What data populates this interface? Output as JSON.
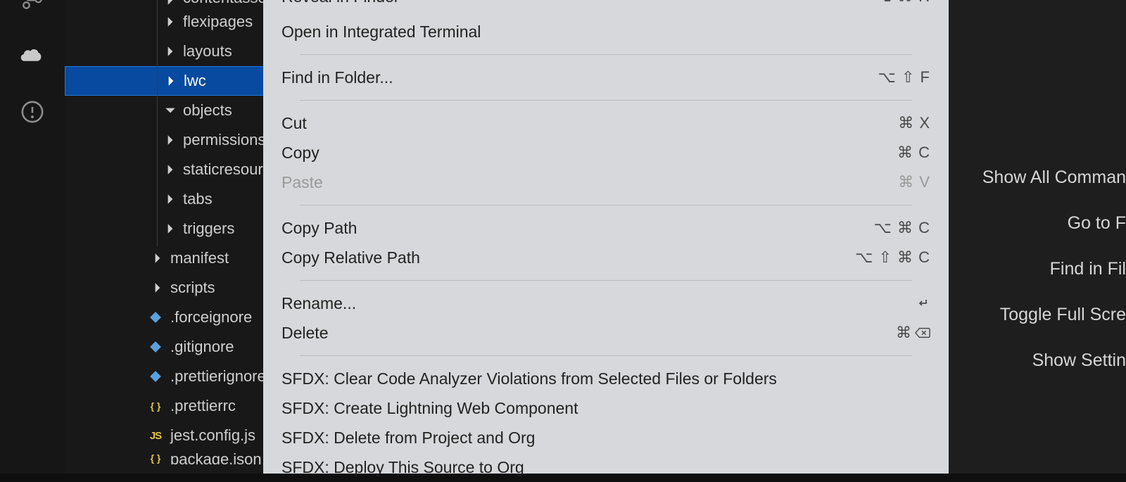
{
  "activity": {
    "icons": [
      "source-control-icon",
      "salesforce-cloud-icon",
      "warning-icon"
    ]
  },
  "sidebar": {
    "tree": [
      {
        "label": "contentassets",
        "depth": 1,
        "chev": "right",
        "type": "folder",
        "cutoff": true
      },
      {
        "label": "flexipages",
        "depth": 1,
        "chev": "right",
        "type": "folder"
      },
      {
        "label": "layouts",
        "depth": 1,
        "chev": "right",
        "type": "folder"
      },
      {
        "label": "lwc",
        "depth": 1,
        "chev": "right",
        "type": "folder",
        "selected": true
      },
      {
        "label": "objects",
        "depth": 1,
        "chev": "down",
        "type": "folder"
      },
      {
        "label": "permissionsets",
        "depth": 1,
        "chev": "right",
        "type": "folder"
      },
      {
        "label": "staticresources",
        "depth": 1,
        "chev": "right",
        "type": "folder"
      },
      {
        "label": "tabs",
        "depth": 1,
        "chev": "right",
        "type": "folder"
      },
      {
        "label": "triggers",
        "depth": 1,
        "chev": "right",
        "type": "folder"
      },
      {
        "label": "manifest",
        "depth": 0,
        "chev": "right",
        "type": "folder"
      },
      {
        "label": "scripts",
        "depth": 0,
        "chev": "right",
        "type": "folder"
      },
      {
        "label": ".forceignore",
        "depth": 0,
        "type": "file",
        "icon": "diamond-blue"
      },
      {
        "label": ".gitignore",
        "depth": 0,
        "type": "file",
        "icon": "diamond-blue"
      },
      {
        "label": ".prettierignore",
        "depth": 0,
        "type": "file",
        "icon": "diamond-blue"
      },
      {
        "label": ".prettierrc",
        "depth": 0,
        "type": "file",
        "icon": "braces-yellow"
      },
      {
        "label": "jest.config.js",
        "depth": 0,
        "type": "file",
        "icon": "js-yellow"
      },
      {
        "label": "package.json",
        "depth": 0,
        "type": "file",
        "icon": "braces-yellow",
        "cutoff": true
      }
    ]
  },
  "contextMenu": {
    "groups": [
      [
        {
          "label": "Reveal in Finder",
          "shortcut": "⌥ ⌘ R",
          "cutoffTop": true
        },
        {
          "label": "Open in Integrated Terminal"
        }
      ],
      [
        {
          "label": "Find in Folder...",
          "shortcut": "⌥ ⇧ F"
        }
      ],
      [
        {
          "label": "Cut",
          "shortcut": "⌘ X"
        },
        {
          "label": "Copy",
          "shortcut": "⌘ C"
        },
        {
          "label": "Paste",
          "shortcut": "⌘ V",
          "disabled": true
        }
      ],
      [
        {
          "label": "Copy Path",
          "shortcut": "⌥ ⌘ C"
        },
        {
          "label": "Copy Relative Path",
          "shortcut": "⌥ ⇧ ⌘ C"
        }
      ],
      [
        {
          "label": "Rename...",
          "shortcut": "↩"
        },
        {
          "label": "Delete",
          "shortcut": "⌘ ⌫"
        }
      ],
      [
        {
          "label": "SFDX: Clear Code Analyzer Violations from Selected Files or Folders"
        },
        {
          "label": "SFDX: Create Lightning Web Component"
        },
        {
          "label": "SFDX: Delete from Project and Org"
        },
        {
          "label": "SFDX: Deploy This Source to Org"
        }
      ]
    ]
  },
  "welcome": {
    "items": [
      "Show All Comman",
      "Go to F",
      "Find in Fil",
      "Toggle Full Scre",
      "Show Settin"
    ]
  }
}
